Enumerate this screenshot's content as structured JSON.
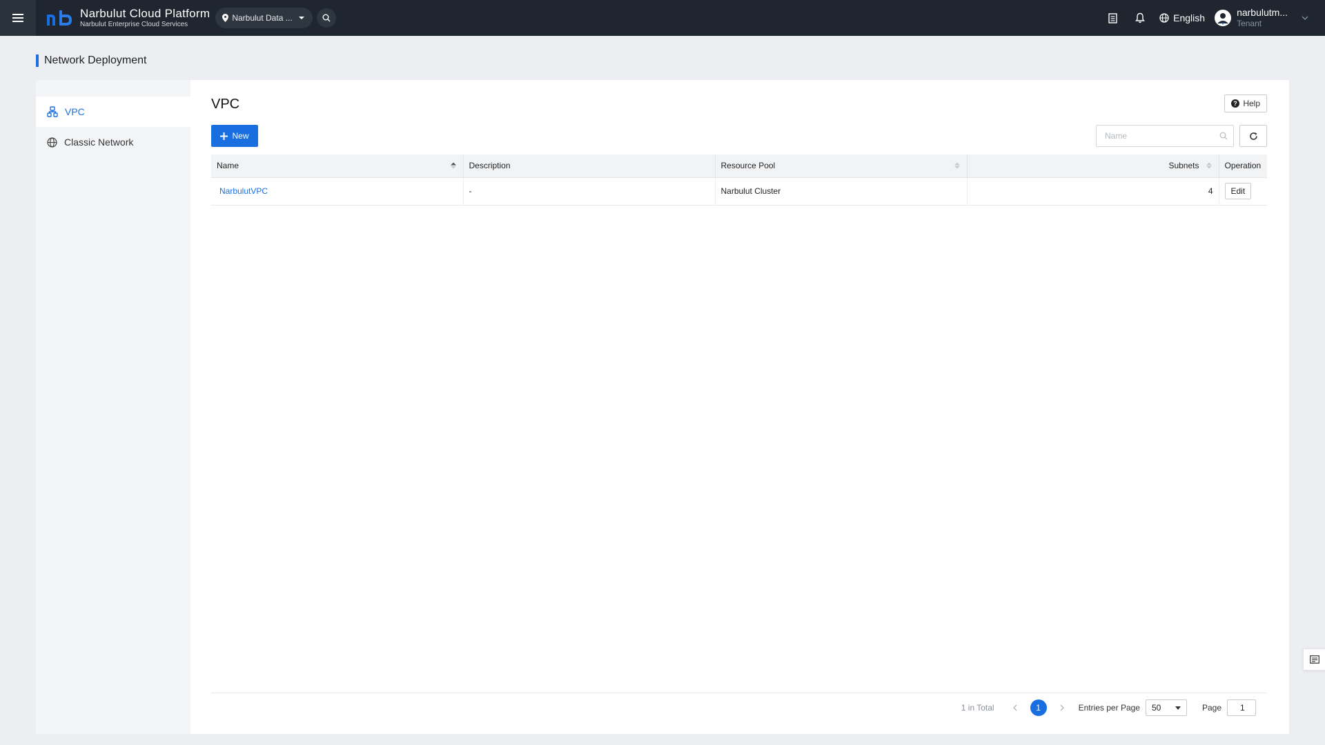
{
  "colors": {
    "accent": "#1a6fe0",
    "topbar": "#1f262f",
    "page_bg": "#eceef2"
  },
  "header": {
    "brand_title": "Narbulut Cloud Platform",
    "brand_subtitle": "Narbulut Enterprise Cloud Services",
    "region": "Narbulut Data ...",
    "language": "English",
    "user_name": "narbulutm...",
    "user_role": "Tenant",
    "icons": [
      "menu-icon",
      "location-pin-icon",
      "search-icon",
      "document-list-icon",
      "bell-icon",
      "globe-icon",
      "user-avatar-icon",
      "chevron-down-icon"
    ]
  },
  "page": {
    "title": "Network Deployment"
  },
  "sidebar": {
    "items": [
      {
        "label": "VPC",
        "icon": "vpc-network-icon",
        "active": true
      },
      {
        "label": "Classic Network",
        "icon": "globe-icon",
        "active": false
      }
    ]
  },
  "main": {
    "title": "VPC",
    "help_label": "Help",
    "new_label": "New",
    "search_placeholder": "Name",
    "columns": [
      "Name",
      "Description",
      "Resource Pool",
      "Subnets",
      "Operation"
    ],
    "rows": [
      {
        "name": "NarbulutVPC",
        "description": "-",
        "resource_pool": "Narbulut Cluster",
        "subnets": "4",
        "operation": "Edit"
      }
    ]
  },
  "pagination": {
    "total": "1 in Total",
    "current_page": "1",
    "entries_label": "Entries per Page",
    "entries_value": "50",
    "page_label": "Page",
    "page_input": "1"
  }
}
